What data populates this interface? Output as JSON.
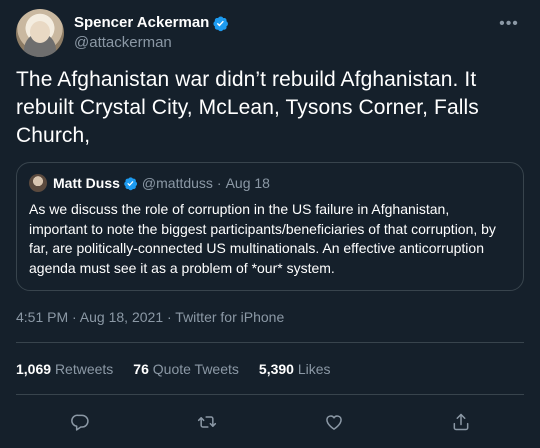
{
  "author": {
    "display_name": "Spencer Ackerman",
    "handle": "@attackerman"
  },
  "more_glyph": "•••",
  "tweet_text": "The Afghanistan war didn’t rebuild Afghanistan. It rebuilt Crystal City, McLean, Tysons Corner, Falls Church,",
  "quoted": {
    "display_name": "Matt Duss",
    "handle": "@mattduss",
    "separator": "·",
    "date": "Aug 18",
    "text": "As we discuss the role of corruption in the US failure in Afghanistan, important to note the biggest participants/beneficiaries of that corruption, by far, are politically-connected US multinationals. An effective anticorruption agenda must see it as a problem of *our* system."
  },
  "timestamp": "4:51 PM · Aug 18, 2021 · Twitter for iPhone",
  "stats": {
    "retweets_count": "1,069",
    "retweets_label": "Retweets",
    "quotes_count": "76",
    "quotes_label": "Quote Tweets",
    "likes_count": "5,390",
    "likes_label": "Likes"
  },
  "colors": {
    "background": "#15202b",
    "secondary_text": "#8b98a5",
    "border": "#38444d",
    "verified_blue": "#1d9bf0"
  },
  "icons": [
    "verified-badge-icon",
    "reply-icon",
    "retweet-icon",
    "like-icon",
    "share-icon",
    "more-icon"
  ]
}
